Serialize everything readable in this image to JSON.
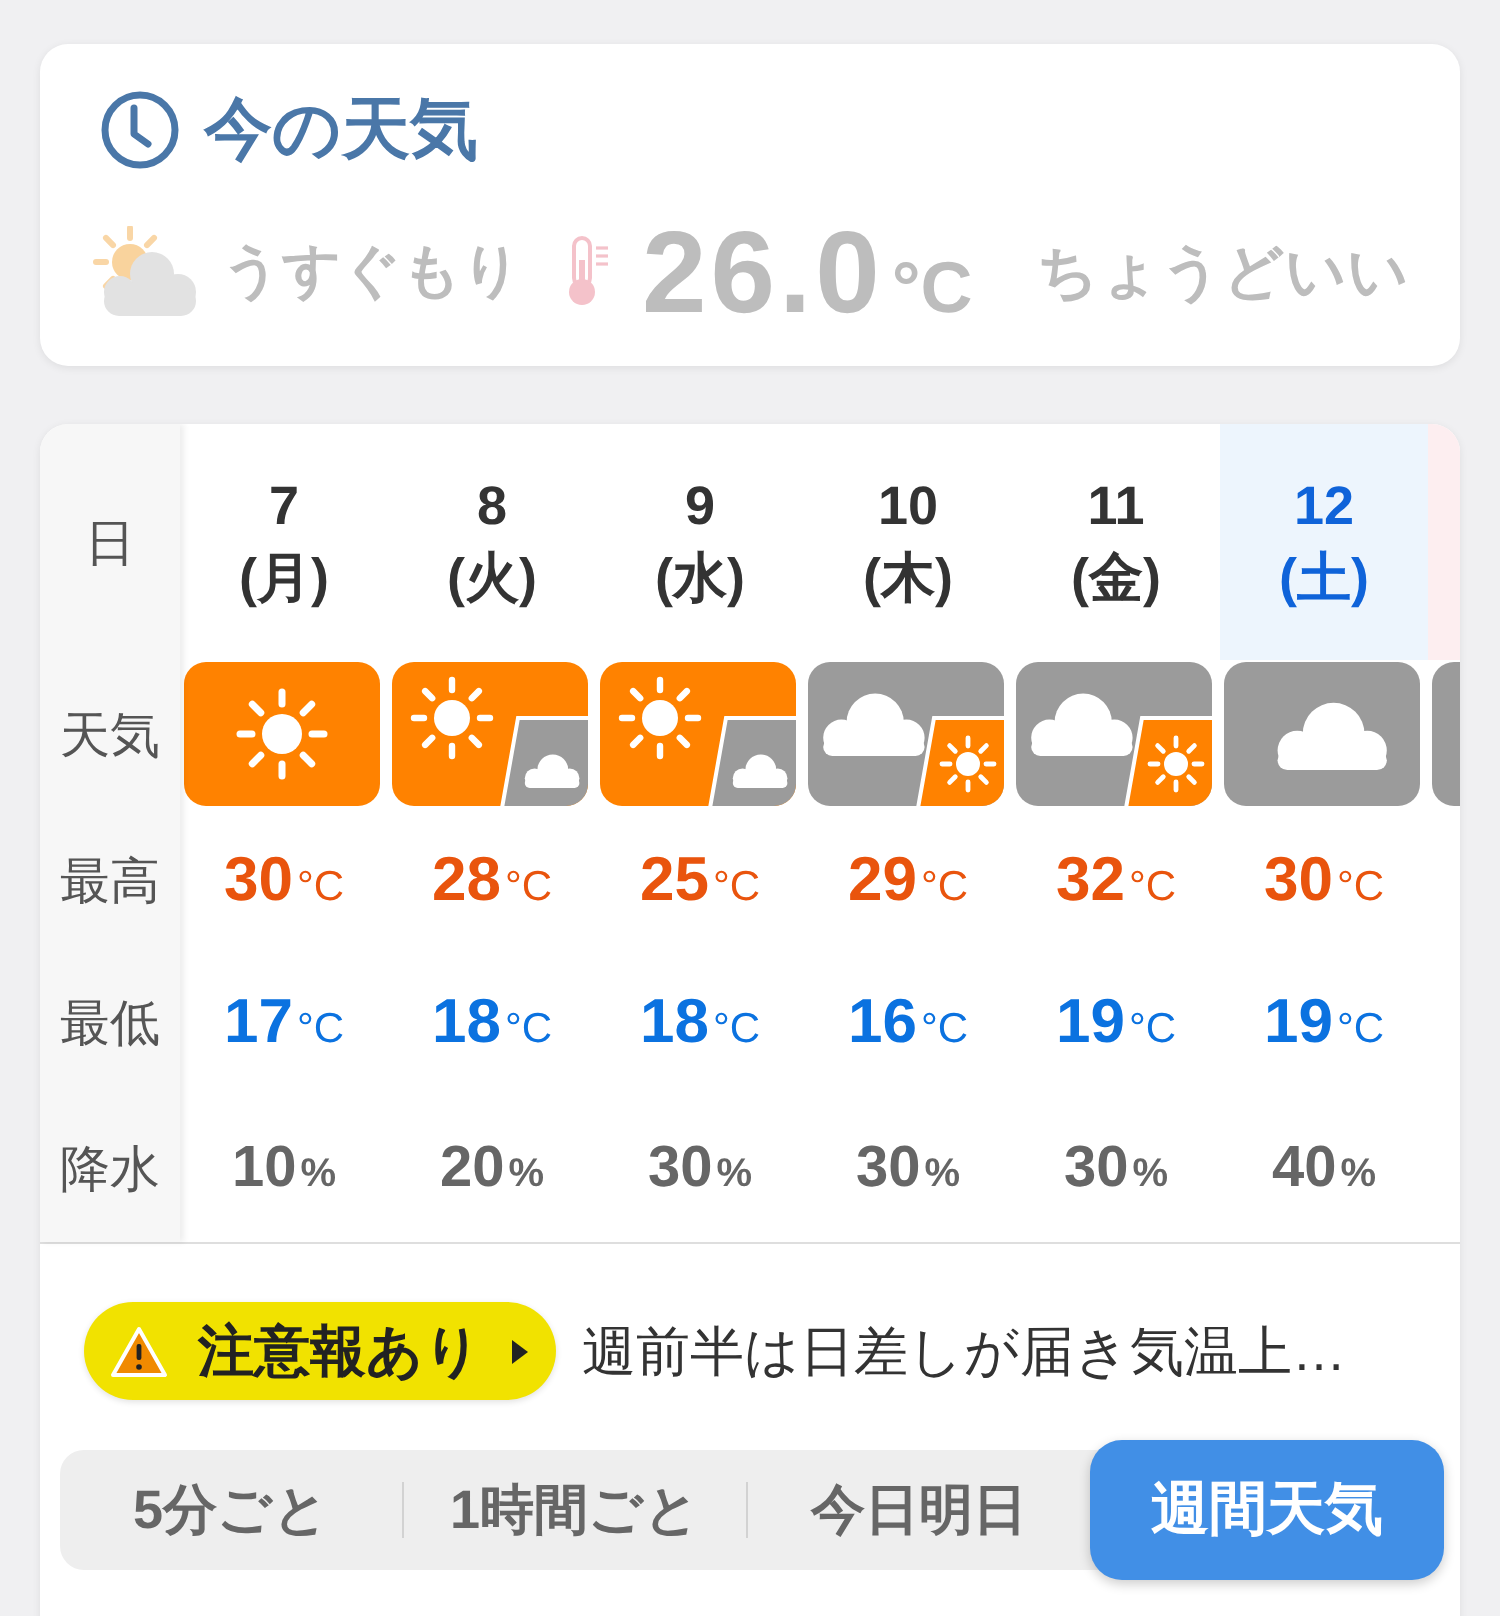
{
  "current": {
    "title": "今の天気",
    "condition": "うすぐもり",
    "temperature": "26.0",
    "unit": "°C",
    "comfort": "ちょうどいい"
  },
  "forecast": {
    "row_labels": [
      "日",
      "天気",
      "最高",
      "最低",
      "降水"
    ],
    "days": [
      {
        "date": "7",
        "weekday": "(月)",
        "kind": "weekday",
        "weather": {
          "kind": "sun"
        },
        "high": {
          "value": "30",
          "unit": "°C"
        },
        "low": {
          "value": "17",
          "unit": "°C"
        },
        "precip": {
          "value": "10",
          "unit": "%"
        }
      },
      {
        "date": "8",
        "weekday": "(火)",
        "kind": "weekday",
        "weather": {
          "kind": "sun-cloud"
        },
        "high": {
          "value": "28",
          "unit": "°C"
        },
        "low": {
          "value": "18",
          "unit": "°C"
        },
        "precip": {
          "value": "20",
          "unit": "%"
        }
      },
      {
        "date": "9",
        "weekday": "(水)",
        "kind": "weekday",
        "weather": {
          "kind": "sun-cloud"
        },
        "high": {
          "value": "25",
          "unit": "°C"
        },
        "low": {
          "value": "18",
          "unit": "°C"
        },
        "precip": {
          "value": "30",
          "unit": "%"
        }
      },
      {
        "date": "10",
        "weekday": "(木)",
        "kind": "weekday",
        "weather": {
          "kind": "cloud-sun"
        },
        "high": {
          "value": "29",
          "unit": "°C"
        },
        "low": {
          "value": "16",
          "unit": "°C"
        },
        "precip": {
          "value": "30",
          "unit": "%"
        }
      },
      {
        "date": "11",
        "weekday": "(金)",
        "kind": "weekday",
        "weather": {
          "kind": "cloud-sun"
        },
        "high": {
          "value": "32",
          "unit": "°C"
        },
        "low": {
          "value": "19",
          "unit": "°C"
        },
        "precip": {
          "value": "30",
          "unit": "%"
        }
      },
      {
        "date": "12",
        "weekday": "(土)",
        "kind": "saturday",
        "weather": {
          "kind": "cloud"
        },
        "high": {
          "value": "30",
          "unit": "°C"
        },
        "low": {
          "value": "19",
          "unit": "°C"
        },
        "precip": {
          "value": "40",
          "unit": "%"
        }
      },
      {
        "kind": "sunday",
        "weather": {
          "kind": "cloud"
        }
      }
    ]
  },
  "notice": {
    "badge": "注意報あり",
    "message": "週前半は日差しが届き気温上…"
  },
  "tabs": [
    {
      "label": "5分ごと",
      "selected": false
    },
    {
      "label": "1時間ごと",
      "selected": false
    },
    {
      "label": "今日明日",
      "selected": false
    },
    {
      "label": "週間天気",
      "selected": true
    }
  ]
}
